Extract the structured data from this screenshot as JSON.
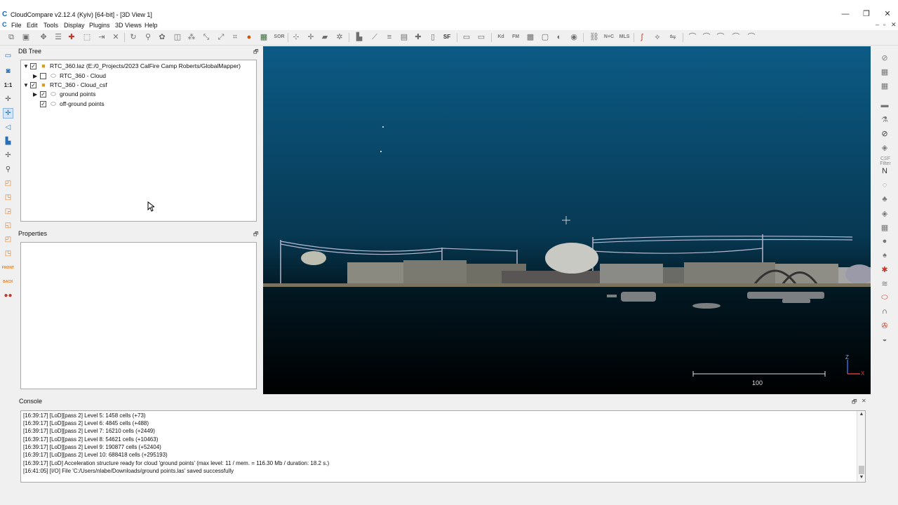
{
  "window": {
    "title": "CloudCompare v2.12.4 (Kyiv) [64-bit] - [3D View 1]",
    "app_logo": "C",
    "min_icon": "—",
    "max_icon": "❐",
    "close_icon": "✕",
    "mdi_min": "–",
    "mdi_restore": "▫",
    "mdi_close": "✕"
  },
  "menubar": {
    "items": [
      "File",
      "Edit",
      "Tools",
      "Display",
      "Plugins",
      "3D Views",
      "Help"
    ]
  },
  "toolbar": {
    "sor_label": "SOR",
    "sf_label": "SF",
    "kd_label": "Kd",
    "fm_label": "FM",
    "nc_label": "N+C",
    "mls_label": "MLS"
  },
  "lefttoolbar": {
    "scale_label": "1:1",
    "front_label": "FRONT",
    "back_label": "BACK"
  },
  "righttoolbar": {
    "csf_label": "CSF Filter",
    "n_label": "N"
  },
  "dbtree": {
    "title": "DB Tree",
    "float_icon": "🗗",
    "items": [
      {
        "label": "RTC_360.laz (E:/0_Projects/2023 CalFire Camp Roberts/GlobalMapper)",
        "arrow": "▼",
        "checked": "✓"
      },
      {
        "label": "RTC_360 - Cloud",
        "arrow": "▶",
        "checked": ""
      },
      {
        "label": "RTC_360 - Cloud_csf",
        "arrow": "▼",
        "checked": "✓"
      },
      {
        "label": "ground points",
        "arrow": "▶",
        "checked": "✓"
      },
      {
        "label": "off-ground points",
        "arrow": "",
        "checked": "✓"
      }
    ]
  },
  "properties": {
    "title": "Properties",
    "float_icon": "🗗"
  },
  "view3d": {
    "scale_value": "100",
    "axis_z": "Z",
    "axis_x": "X",
    "colors": {
      "top": "#0c5b86",
      "bottom": "#000000"
    }
  },
  "console": {
    "title": "Console",
    "float_icon": "🗗",
    "close_icon": "✕",
    "lines": [
      "[16:39:17] [LoD][pass 2] Level 5: 1458 cells (+73)",
      "[16:39:17] [LoD][pass 2] Level 6: 4845 cells (+488)",
      "[16:39:17] [LoD][pass 2] Level 7: 16210 cells (+2449)",
      "[16:39:17] [LoD][pass 2] Level 8: 54621 cells (+10463)",
      "[16:39:17] [LoD][pass 2] Level 9: 190877 cells (+52404)",
      "[16:39:17] [LoD][pass 2] Level 10: 688418 cells (+295193)",
      "[16:39:17] [LoD] Acceleration structure ready for cloud 'ground points' (max level: 11 / mem. = 116.30 Mb / duration: 18.2 s.)",
      "[16:41:05] [I/O] File 'C:/Users/nlabe/Downloads/ground points.las' saved successfully"
    ]
  }
}
